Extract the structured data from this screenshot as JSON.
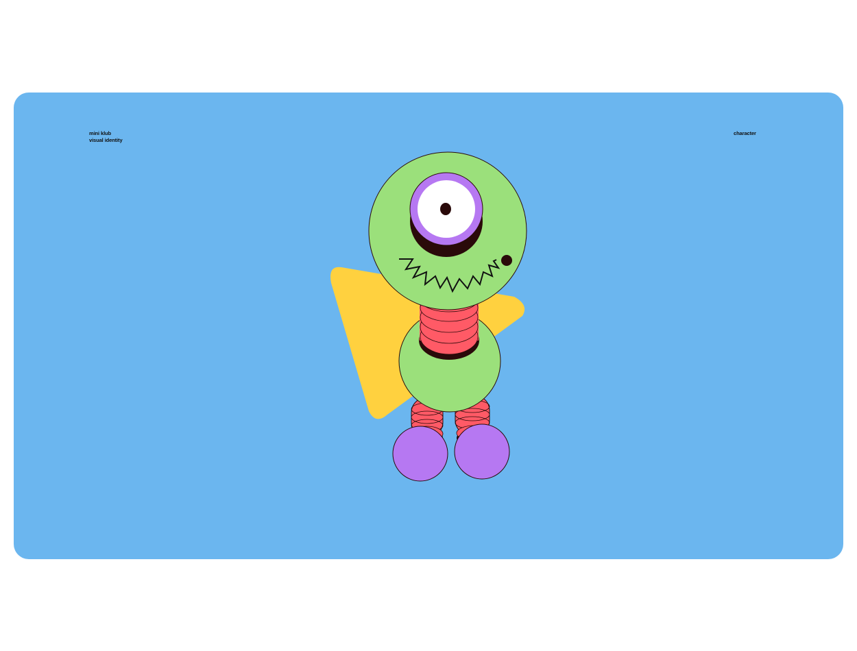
{
  "header": {
    "brand_line1": "mini klub",
    "brand_line2": "visual identity",
    "section": "character"
  },
  "colors": {
    "background": "#6bb6ef",
    "head": "#9be07b",
    "eye_ring": "#b678f2",
    "leg": "#ff5a66",
    "foot": "#b678f2",
    "triangle": "#ffd13f",
    "outline": "#2a0a0a"
  },
  "illustration": {
    "subject": "one-eyed-monster-character"
  }
}
